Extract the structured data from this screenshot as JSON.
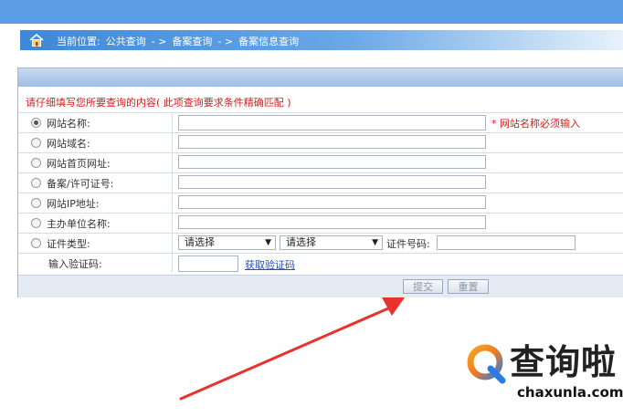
{
  "breadcrumb": {
    "prefix": "当前位置:",
    "item1": "公共查询",
    "sep1": "- >",
    "item2": "备案查询",
    "sep2": "- >",
    "item3": "备案信息查询"
  },
  "form": {
    "hint": "请仔细填写您所要查询的内容( 此项查询要求条件精确匹配 )",
    "rows": [
      {
        "label": "网站名称:",
        "checked": true
      },
      {
        "label": "网站域名:",
        "checked": false
      },
      {
        "label": "网站首页网址:",
        "checked": false
      },
      {
        "label": "备案/许可证号:",
        "checked": false
      },
      {
        "label": "网站IP地址:",
        "checked": false
      },
      {
        "label": "主办单位名称:",
        "checked": false
      },
      {
        "label": "证件类型:",
        "checked": false
      }
    ],
    "required_note": "* 网站名称必须输入",
    "select1": "请选择",
    "select2": "请选择",
    "select_arrow": "▼",
    "cert_no_label": "证件号码:",
    "captcha_label": "输入验证码:",
    "captcha_link": "获取验证码",
    "submit_label": "提交",
    "reset_label": "重置"
  },
  "watermark": {
    "cn": "查询啦",
    "en": "chaxunla.com"
  }
}
